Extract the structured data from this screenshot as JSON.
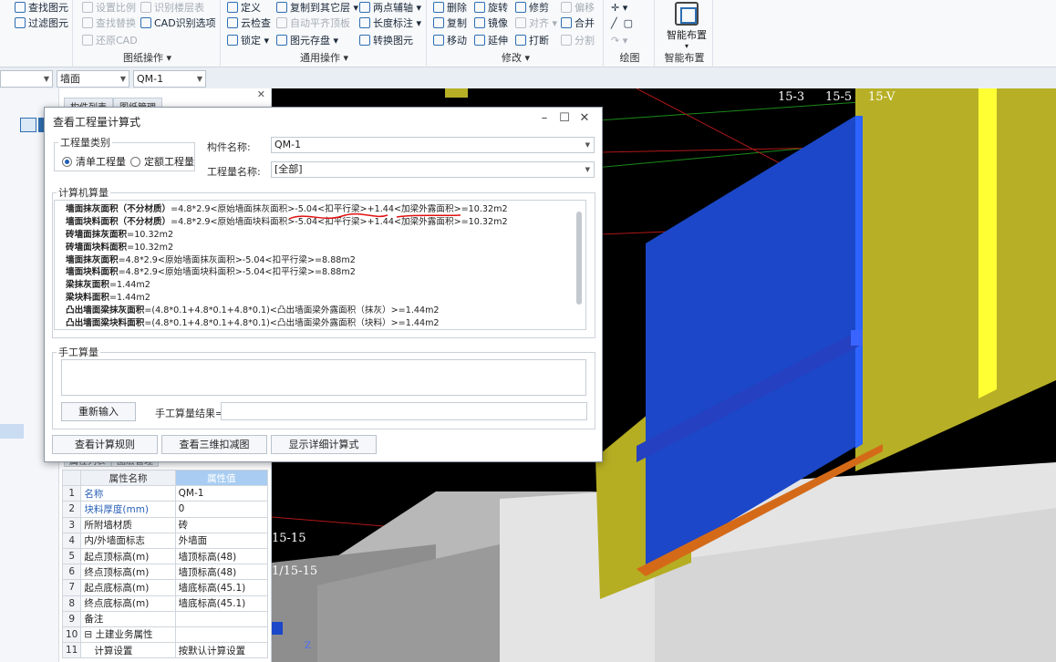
{
  "ribbon": {
    "group1": {
      "items": [
        "查找图元",
        "过滤图元"
      ]
    },
    "group2": {
      "label": "图纸操作",
      "items": [
        "设置比例",
        "识别楼层表",
        "查找替换",
        "CAD识别选项",
        "还原CAD"
      ]
    },
    "group3": {
      "label": "通用操作",
      "items": [
        "定义",
        "复制到其它层",
        "两点辅轴",
        "云检查",
        "自动平齐顶板",
        "长度标注",
        "锁定",
        "图元存盘",
        "转换图元"
      ]
    },
    "group4": {
      "label": "修改",
      "items": [
        "删除",
        "旋转",
        "修剪",
        "偏移",
        "复制",
        "镜像",
        "对齐",
        "合并",
        "移动",
        "延伸",
        "打断",
        "分割"
      ]
    },
    "group5": {
      "label": "绘图"
    },
    "group6": {
      "label": "智能布置",
      "button": "智能布置"
    }
  },
  "toolbar": {
    "combo_type": "墙面",
    "combo_name": "QM-1"
  },
  "left_panel": {
    "tabs": [
      "构件列表",
      "图纸管理"
    ],
    "prop_tabs": [
      "属性列表",
      "图层管理"
    ],
    "prop_headers": [
      "属性名称",
      "属性值"
    ],
    "props": [
      {
        "n": "1",
        "name": "名称",
        "value": "QM-1",
        "blue": true
      },
      {
        "n": "2",
        "name": "块料厚度(mm)",
        "value": "0",
        "blue": true
      },
      {
        "n": "3",
        "name": "所附墙材质",
        "value": "砖",
        "blue": false
      },
      {
        "n": "4",
        "name": "内/外墙面标志",
        "value": "外墙面",
        "blue": false
      },
      {
        "n": "5",
        "name": "起点顶标高(m)",
        "value": "墙顶标高(48)",
        "blue": false
      },
      {
        "n": "6",
        "name": "终点顶标高(m)",
        "value": "墙顶标高(48)",
        "blue": false
      },
      {
        "n": "7",
        "name": "起点底标高(m)",
        "value": "墙底标高(45.1)",
        "blue": false
      },
      {
        "n": "8",
        "name": "终点底标高(m)",
        "value": "墙底标高(45.1)",
        "blue": false
      },
      {
        "n": "9",
        "name": "备注",
        "value": "",
        "blue": false
      },
      {
        "n": "10",
        "name": "⊟ 土建业务属性",
        "value": "",
        "blue": false
      },
      {
        "n": "11",
        "name": "计算设置",
        "value": "按默认计算设置",
        "blue": false
      }
    ]
  },
  "view3d": {
    "labels": [
      "15-3",
      "15-5",
      "15-V",
      "15-15",
      "1/15-15"
    ],
    "axis": "Z"
  },
  "dialog": {
    "title": "查看工程量计算式",
    "qty_type_legend": "工程量类别",
    "radio1": "清单工程量",
    "radio2": "定额工程量",
    "comp_name_label": "构件名称:",
    "comp_name_value": "QM-1",
    "qty_name_label": "工程量名称:",
    "qty_name_value": "[全部]",
    "calc_legend": "计算机算量",
    "calc_lines": [
      {
        "name": "墙面抹灰面积（不分材质）",
        "expr": "=4.8*2.9<原始墙面抹灰面积>-5.04<扣平行梁>+1.44<加梁外露面积>=10.32m2"
      },
      {
        "name": "墙面块料面积（不分材质）",
        "expr": "=4.8*2.9<原始墙面块料面积>-5.04<扣平行梁>+1.44<加梁外露面积>=10.32m2"
      },
      {
        "name": "砖墙面抹灰面积",
        "expr": "=10.32m2"
      },
      {
        "name": "砖墙面块料面积",
        "expr": "=10.32m2"
      },
      {
        "name": "墙面抹灰面积",
        "expr": "=4.8*2.9<原始墙面抹灰面积>-5.04<扣平行梁>=8.88m2"
      },
      {
        "name": "墙面块料面积",
        "expr": "=4.8*2.9<原始墙面块料面积>-5.04<扣平行梁>=8.88m2"
      },
      {
        "name": "梁抹灰面积",
        "expr": "=1.44m2"
      },
      {
        "name": "梁块料面积",
        "expr": "=1.44m2"
      },
      {
        "name": "凸出墙面梁抹灰面积",
        "expr": "=(4.8*0.1+4.8*0.1+4.8*0.1)<凸出墙面梁外露面积（抹灰）>=1.44m2"
      },
      {
        "name": "凸出墙面梁块料面积",
        "expr": "=(4.8*0.1+4.8*0.1+4.8*0.1)<凸出墙面梁外露面积（块料）>=1.44m2"
      }
    ],
    "manual_legend": "手工算量",
    "reinput_btn": "重新输入",
    "manual_result_label": "手工算量结果=",
    "btn_rules": "查看计算规则",
    "btn_3d": "查看三维扣减图",
    "btn_detail": "显示详细计算式"
  }
}
